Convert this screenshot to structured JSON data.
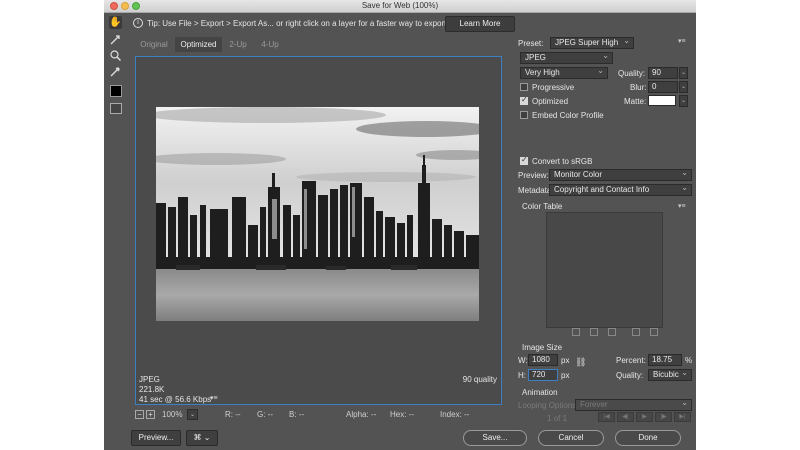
{
  "window": {
    "title": "Save for Web (100%)"
  },
  "tip": {
    "icon": "info-icon",
    "text": "Tip: Use File > Export > Export As... or right click on a layer for a faster way to export assets",
    "learn_more": "Learn More"
  },
  "tabs": [
    {
      "label": "Original"
    },
    {
      "label": "Optimized"
    },
    {
      "label": "2-Up"
    },
    {
      "label": "4-Up"
    }
  ],
  "tools": [
    "hand-tool-icon",
    "slice-select-tool-icon",
    "zoom-tool-icon",
    "eyedropper-tool-icon"
  ],
  "preview": {
    "format": "JPEG",
    "size": "221.8K",
    "time": "41 sec @ 56.6 Kbps",
    "quality": "90 quality"
  },
  "status": {
    "zoom": "100%",
    "r": "R: --",
    "g": "G: --",
    "b": "B: --",
    "alpha": "Alpha: --",
    "hex": "Hex: --",
    "index": "Index: --"
  },
  "settings": {
    "preset_label": "Preset:",
    "preset": "JPEG Super High",
    "format": "JPEG",
    "compression": "Very High",
    "quality_label": "Quality:",
    "quality": "90",
    "progressive": {
      "label": "Progressive",
      "checked": false
    },
    "blur_label": "Blur:",
    "blur": "0",
    "optimized": {
      "label": "Optimized",
      "checked": true
    },
    "matte_label": "Matte:",
    "matte_color": "#ffffff",
    "embed": {
      "label": "Embed Color Profile",
      "checked": false
    },
    "convert": {
      "label": "Convert to sRGB",
      "checked": true
    },
    "preview_label": "Preview:",
    "preview": "Monitor Color",
    "metadata_label": "Metadata:",
    "metadata": "Copyright and Contact Info",
    "color_table_label": "Color Table"
  },
  "image_size": {
    "heading": "Image Size",
    "w_label": "W:",
    "w": "1080",
    "h_label": "H:",
    "h": "720",
    "unit": "px",
    "percent_label": "Percent:",
    "percent": "18.75",
    "percent_unit": "%",
    "quality_label": "Quality:",
    "quality": "Bicubic"
  },
  "animation": {
    "heading": "Animation",
    "looping_label": "Looping Options:",
    "looping": "Forever",
    "frame": "1 of 1"
  },
  "buttons": {
    "preview": "Preview...",
    "save": "Save...",
    "cancel": "Cancel",
    "done": "Done"
  },
  "colors": {
    "dialog_bg": "#535353",
    "selection_border": "#3e7fc1"
  }
}
